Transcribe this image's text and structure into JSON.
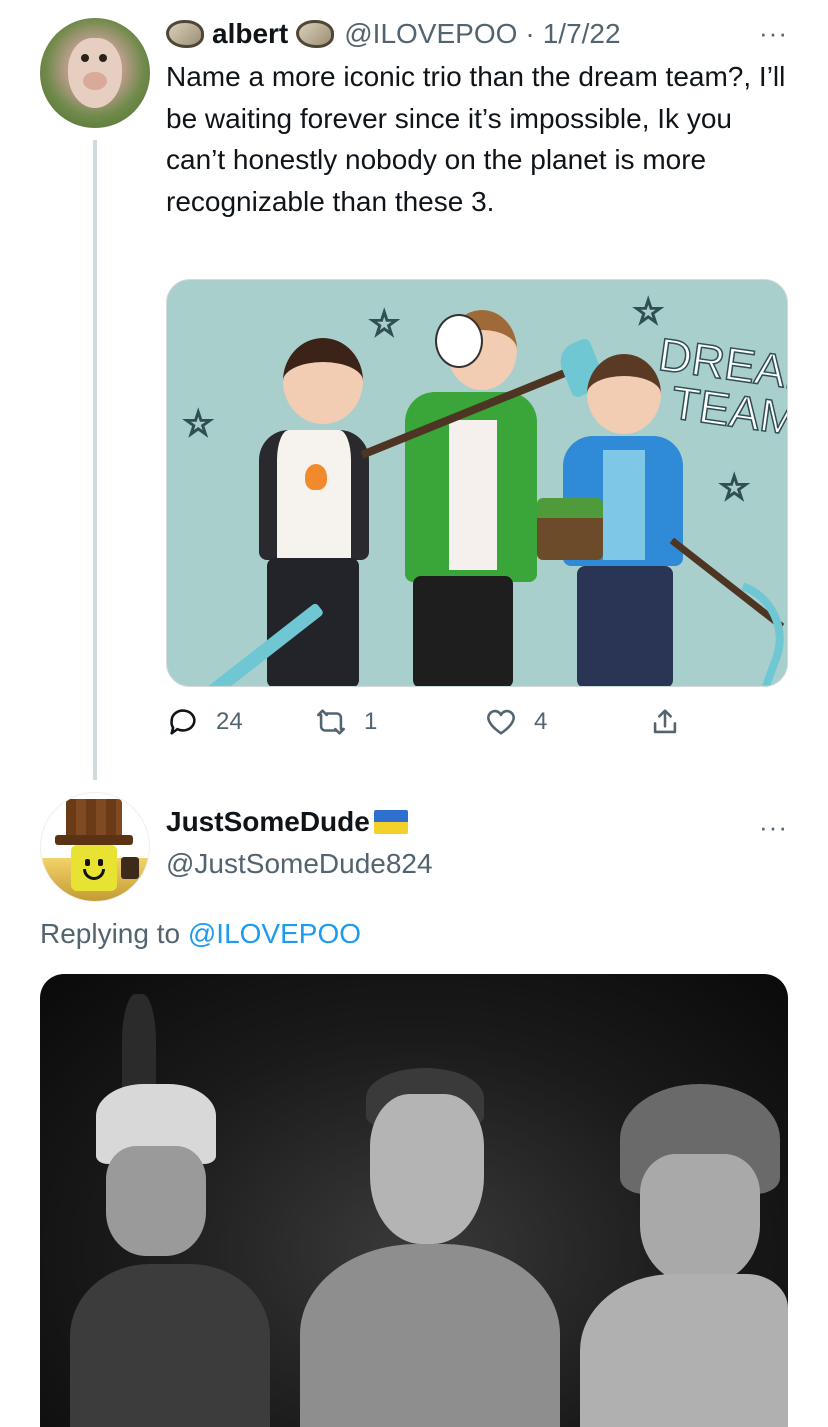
{
  "tweet1": {
    "display_name": "albert",
    "handle": "@ILOVEPOO",
    "separator": "·",
    "date": "1/7/22",
    "more": "···",
    "text": "Name a more iconic trio than the dream team?, I’ll be waiting forever since it’s impossible, Ik you can’t honestly nobody on the planet is more recognizable than these 3.",
    "image_lettering": [
      "DREAM",
      "TEAM"
    ],
    "actions": {
      "reply_count": "24",
      "retweet_count": "1",
      "like_count": "4"
    },
    "icons": [
      "reply-icon",
      "retweet-icon",
      "like-icon",
      "share-icon"
    ]
  },
  "tweet2": {
    "display_name": "JustSomeDude",
    "handle": "@JustSomeDude824",
    "more": "···",
    "replying_prefix": "Replying to",
    "replying_mention": "@ILOVEPOO"
  },
  "colors": {
    "text_primary": "#0f1419",
    "text_secondary": "#536471",
    "link": "#1d9bf0",
    "thread_line": "#cfd9de",
    "illustration_bg": "#a9cfcd"
  }
}
